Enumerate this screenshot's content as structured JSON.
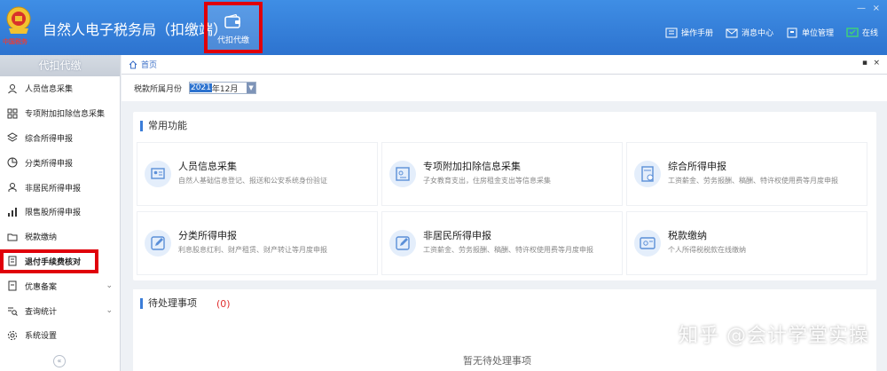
{
  "header": {
    "logo_caption": "中国税务",
    "title": "自然人电子税务局（扣缴端）",
    "agent_tab_label": "代扣代缴",
    "links": [
      {
        "label": "操作手册",
        "icon": "manual-icon"
      },
      {
        "label": "消息中心",
        "icon": "mail-icon"
      },
      {
        "label": "单位管理",
        "icon": "building-icon"
      },
      {
        "label": "在线",
        "icon": "online-status-icon"
      }
    ],
    "window_controls": {
      "minimize": "—",
      "close": "×"
    }
  },
  "sidebar": {
    "heading": "代扣代缴",
    "items": [
      {
        "label": "人员信息采集",
        "icon": "person-icon",
        "expandable": false,
        "highlighted": false
      },
      {
        "label": "专项附加扣除信息采集",
        "icon": "grid-icon",
        "expandable": false,
        "highlighted": false
      },
      {
        "label": "综合所得申报",
        "icon": "layers-icon",
        "expandable": false,
        "highlighted": false
      },
      {
        "label": "分类所得申报",
        "icon": "pie-icon",
        "expandable": false,
        "highlighted": false
      },
      {
        "label": "非居民所得申报",
        "icon": "person-outline-icon",
        "expandable": false,
        "highlighted": false
      },
      {
        "label": "限售股所得申报",
        "icon": "bar-chart-icon",
        "expandable": false,
        "highlighted": false
      },
      {
        "label": "税款缴纳",
        "icon": "folder-icon",
        "expandable": false,
        "highlighted": false
      },
      {
        "label": "退付手续费核对",
        "icon": "document-check-icon",
        "expandable": false,
        "highlighted": true
      },
      {
        "label": "优惠备案",
        "icon": "file-icon",
        "expandable": true,
        "highlighted": false
      },
      {
        "label": "查询统计",
        "icon": "query-icon",
        "expandable": true,
        "highlighted": false
      },
      {
        "label": "系统设置",
        "icon": "gear-icon",
        "expandable": false,
        "highlighted": false
      }
    ],
    "collapse_glyph": "«"
  },
  "breadcrumb": {
    "home": "首页",
    "icon": "home-icon"
  },
  "filter": {
    "label": "税款所属月份",
    "year": "2021",
    "month": "年12月"
  },
  "common": {
    "title": "常用功能",
    "cards": [
      {
        "title": "人员信息采集",
        "desc": "自然人基础信息登记、报送和公安系统身份验证",
        "icon": "id-card-icon"
      },
      {
        "title": "专项附加扣除信息采集",
        "desc": "子女教育支出，住房租金支出等信息采集",
        "icon": "deduction-icon"
      },
      {
        "title": "综合所得申报",
        "desc": "工资薪金、劳务报酬、稿酬、特许权使用费等月度申报",
        "icon": "report-icon"
      },
      {
        "title": "分类所得申报",
        "desc": "利息股息红利、财产租赁、财产转让等月度申报",
        "icon": "edit-icon"
      },
      {
        "title": "非居民所得申报",
        "desc": "工资薪金、劳务报酬、稿酬、特许权使用费等月度申报",
        "icon": "edit-icon"
      },
      {
        "title": "税款缴纳",
        "desc": "个人所得税税款在线缴纳",
        "icon": "payment-icon"
      }
    ]
  },
  "pending": {
    "title": "待处理事项",
    "count": "(0)",
    "empty": "暂无待处理事项"
  },
  "watermark": "知乎 @会计学堂实操"
}
